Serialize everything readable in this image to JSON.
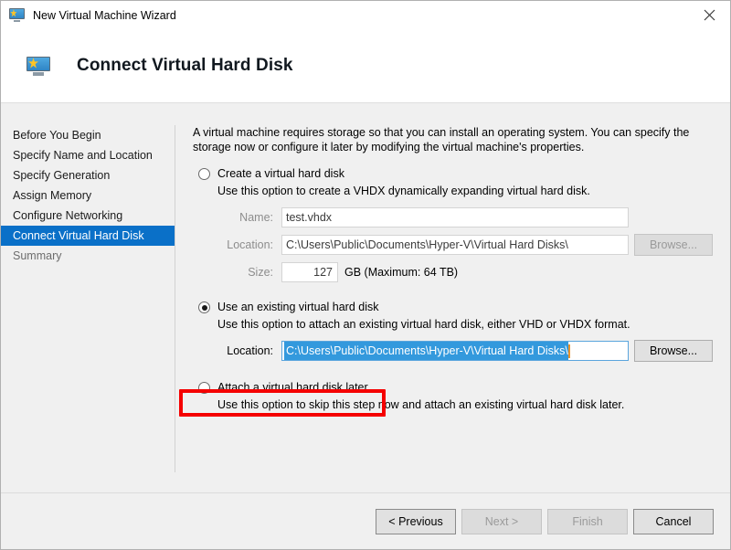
{
  "window": {
    "title": "New Virtual Machine Wizard",
    "title_icon": "virtual-machine-icon",
    "close_icon": "close-icon"
  },
  "header": {
    "icon": "virtual-machine-icon",
    "title": "Connect Virtual Hard Disk"
  },
  "sidebar": {
    "items": [
      {
        "label": "Before You Begin",
        "state": "normal"
      },
      {
        "label": "Specify Name and Location",
        "state": "normal"
      },
      {
        "label": "Specify Generation",
        "state": "normal"
      },
      {
        "label": "Assign Memory",
        "state": "normal"
      },
      {
        "label": "Configure Networking",
        "state": "normal"
      },
      {
        "label": "Connect Virtual Hard Disk",
        "state": "selected"
      },
      {
        "label": "Summary",
        "state": "dim"
      }
    ]
  },
  "main": {
    "intro": "A virtual machine requires storage so that you can install an operating system. You can specify the storage now or configure it later by modifying the virtual machine's properties.",
    "options": [
      {
        "label": "Create a virtual hard disk",
        "description": "Use this option to create a VHDX dynamically expanding virtual hard disk.",
        "selected": false
      },
      {
        "label": "Use an existing virtual hard disk",
        "description": "Use this option to attach an existing virtual hard disk, either VHD or VHDX format.",
        "selected": true
      },
      {
        "label": "Attach a virtual hard disk later",
        "description": "Use this option to skip this step now and attach an existing virtual hard disk later.",
        "selected": false
      }
    ],
    "create_fields": {
      "name_label": "Name:",
      "name_value": "test.vhdx",
      "location_label": "Location:",
      "location_value": "C:\\Users\\Public\\Documents\\Hyper-V\\Virtual Hard Disks\\",
      "browse_label": "Browse...",
      "size_label": "Size:",
      "size_value": "127",
      "size_units": "GB (Maximum: 64 TB)"
    },
    "existing_fields": {
      "location_label": "Location:",
      "location_value": "C:\\Users\\Public\\Documents\\Hyper-V\\Virtual Hard Disks\\",
      "browse_label": "Browse..."
    },
    "annotation": {
      "color": "#f50000"
    }
  },
  "footer": {
    "previous_label": "< Previous",
    "next_label": "Next >",
    "finish_label": "Finish",
    "cancel_label": "Cancel"
  },
  "colors": {
    "selection_blue": "#0a70c8",
    "text_selection": "#3399dd",
    "caret": "#e8922a",
    "annotation_red": "#f50000"
  }
}
